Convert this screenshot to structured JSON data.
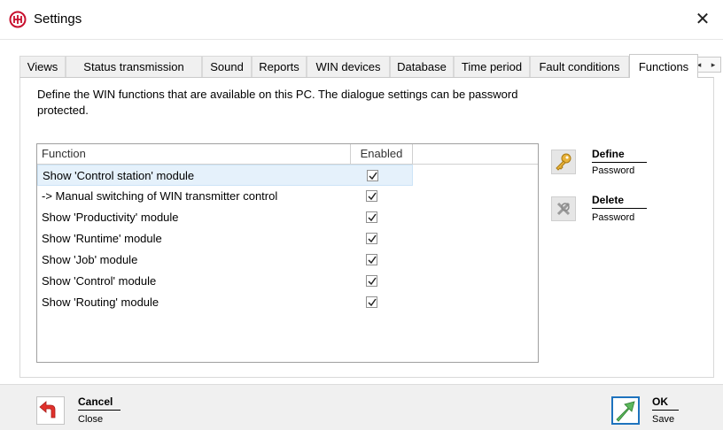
{
  "window": {
    "title": "Settings",
    "close_symbol": "✕"
  },
  "tabs": [
    {
      "label": "Views"
    },
    {
      "label": "Status transmission"
    },
    {
      "label": "Sound"
    },
    {
      "label": "Reports"
    },
    {
      "label": "WIN devices"
    },
    {
      "label": "Database"
    },
    {
      "label": "Time period"
    },
    {
      "label": "Fault conditions"
    },
    {
      "label": "Functions",
      "active": true
    }
  ],
  "tab_scroll": {
    "left": "◂",
    "right": "▸"
  },
  "description": "Define the WIN functions that are available on this PC. The dialogue settings can be password protected.",
  "grid": {
    "headers": {
      "function": "Function",
      "enabled": "Enabled"
    },
    "rows": [
      {
        "label": "Show 'Control station' module",
        "enabled": true,
        "selected": true
      },
      {
        "label": "-> Manual switching of WIN transmitter control",
        "enabled": true
      },
      {
        "label": "Show 'Productivity' module",
        "enabled": true
      },
      {
        "label": "Show 'Runtime' module",
        "enabled": true
      },
      {
        "label": "Show 'Job' module",
        "enabled": true
      },
      {
        "label": "Show 'Control' module",
        "enabled": true
      },
      {
        "label": "Show 'Routing' module",
        "enabled": true
      }
    ]
  },
  "password_actions": {
    "define": {
      "title": "Define",
      "sub": "Password",
      "icon": "key-icon"
    },
    "delete": {
      "title": "Delete",
      "sub": "Password",
      "icon": "delete-key-icon"
    }
  },
  "footer": {
    "cancel": {
      "title": "Cancel",
      "sub": "Close",
      "icon": "back-arrow-icon"
    },
    "ok": {
      "title": "OK",
      "sub": "Save",
      "icon": "ok-arrow-icon"
    }
  },
  "colors": {
    "accent_red": "#c8102e",
    "selection": "#e5f1fb",
    "ok_green": "#5cb85c",
    "ok_border": "#1e73be",
    "key_gold": "#e8b23a"
  }
}
